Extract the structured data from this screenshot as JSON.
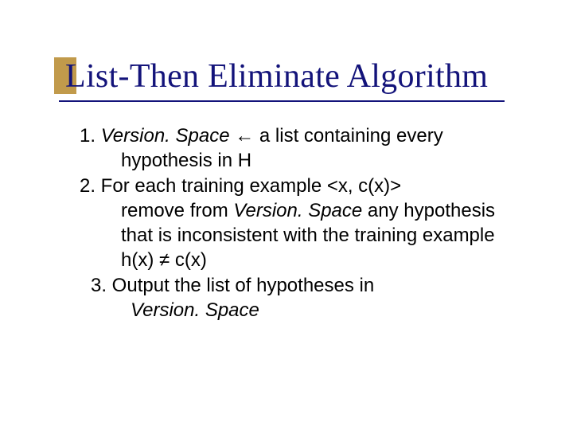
{
  "title": "List-Then Eliminate Algorithm",
  "vs_term": "Version. Space",
  "arrow": " ← ",
  "step1_lead": "a list containing every",
  "step1_cont": "hypothesis in H",
  "step2_lead": "2. For each training example <x, c(x)>",
  "step2_cont_a": "remove from ",
  "step2_cont_b": " any hypothesis that is inconsistent with the training example h(x) ≠ c(x)",
  "step3_lead": "3. Output the list of hypotheses in",
  "nums": {
    "one": "1. "
  }
}
